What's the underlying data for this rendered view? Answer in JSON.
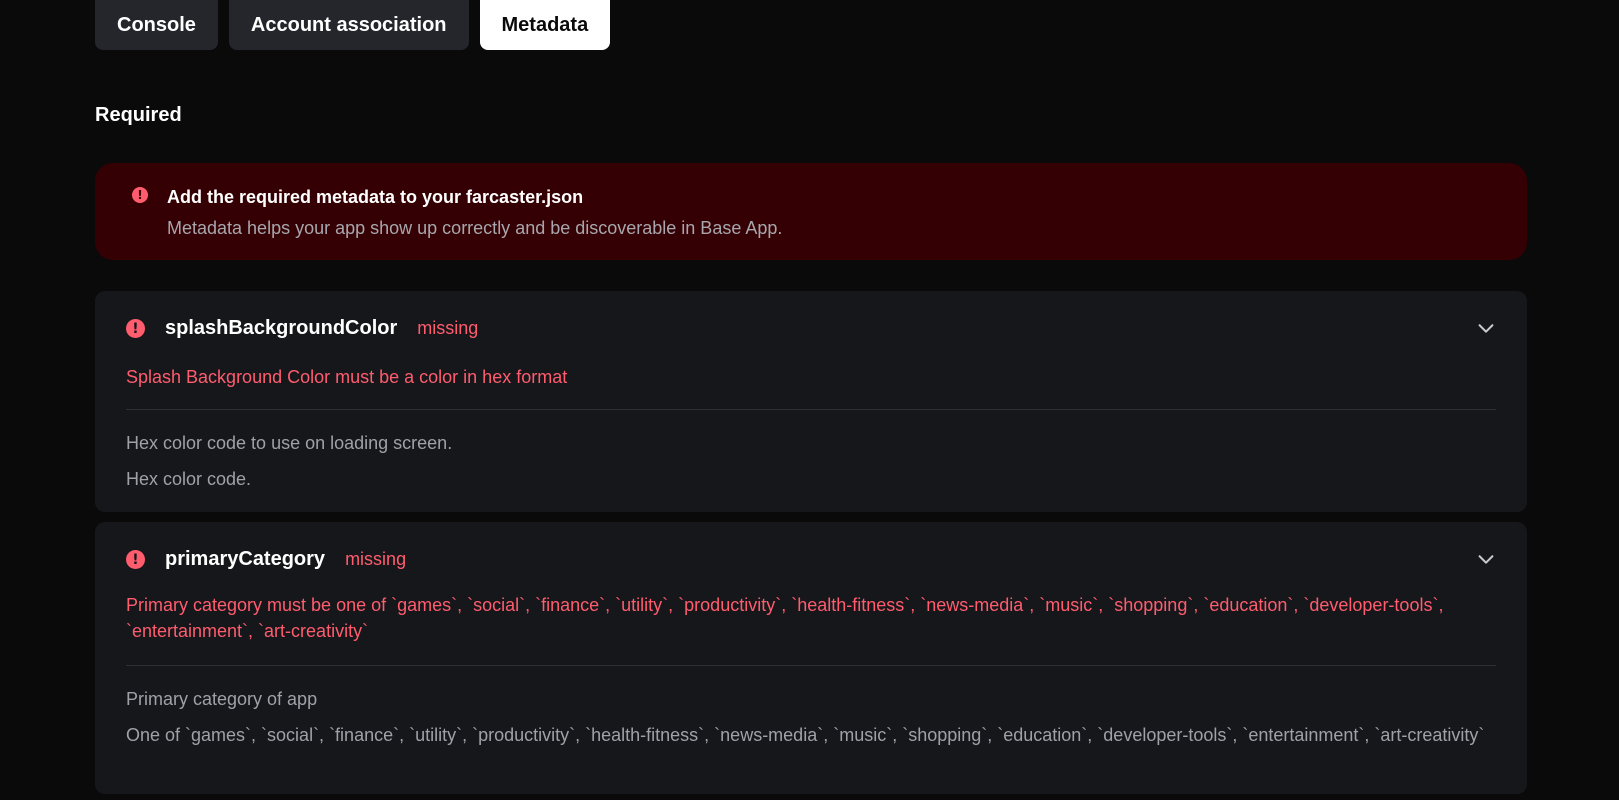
{
  "tabs": [
    {
      "label": "Console",
      "active": false
    },
    {
      "label": "Account association",
      "active": false
    },
    {
      "label": "Metadata",
      "active": true
    }
  ],
  "section": {
    "title": "Required"
  },
  "alert": {
    "icon": "info-icon",
    "title": "Add the required metadata to your farcaster.json",
    "description": "Metadata helps your app show up correctly and be discoverable in Base App."
  },
  "fields": [
    {
      "icon": "error-icon",
      "name": "splashBackgroundColor",
      "status": "missing",
      "error": "Splash Background Color must be a color in hex format",
      "description": "Hex color code to use on loading screen.",
      "hint": "Hex color code."
    },
    {
      "icon": "error-icon",
      "name": "primaryCategory",
      "status": "missing",
      "error": "Primary category must be one of `games`, `social`, `finance`, `utility`, `productivity`, `health-fitness`, `news-media`, `music`, `shopping`, `education`, `developer-tools`, `entertainment`, `art-creativity`",
      "description": "Primary category of app",
      "hint": "One of `games`, `social`, `finance`, `utility`, `productivity`, `health-fitness`, `news-media`, `music`, `shopping`, `education`, `developer-tools`, `entertainment`, `art-creativity`"
    }
  ],
  "colors": {
    "background": "#0a0a0b",
    "tab_bg": "#24262c",
    "tab_active_bg": "#ffffff",
    "alert_bg": "#350004",
    "card_bg": "#16171b",
    "error": "#ff5c6e",
    "muted_text": "#a0a0a7"
  }
}
